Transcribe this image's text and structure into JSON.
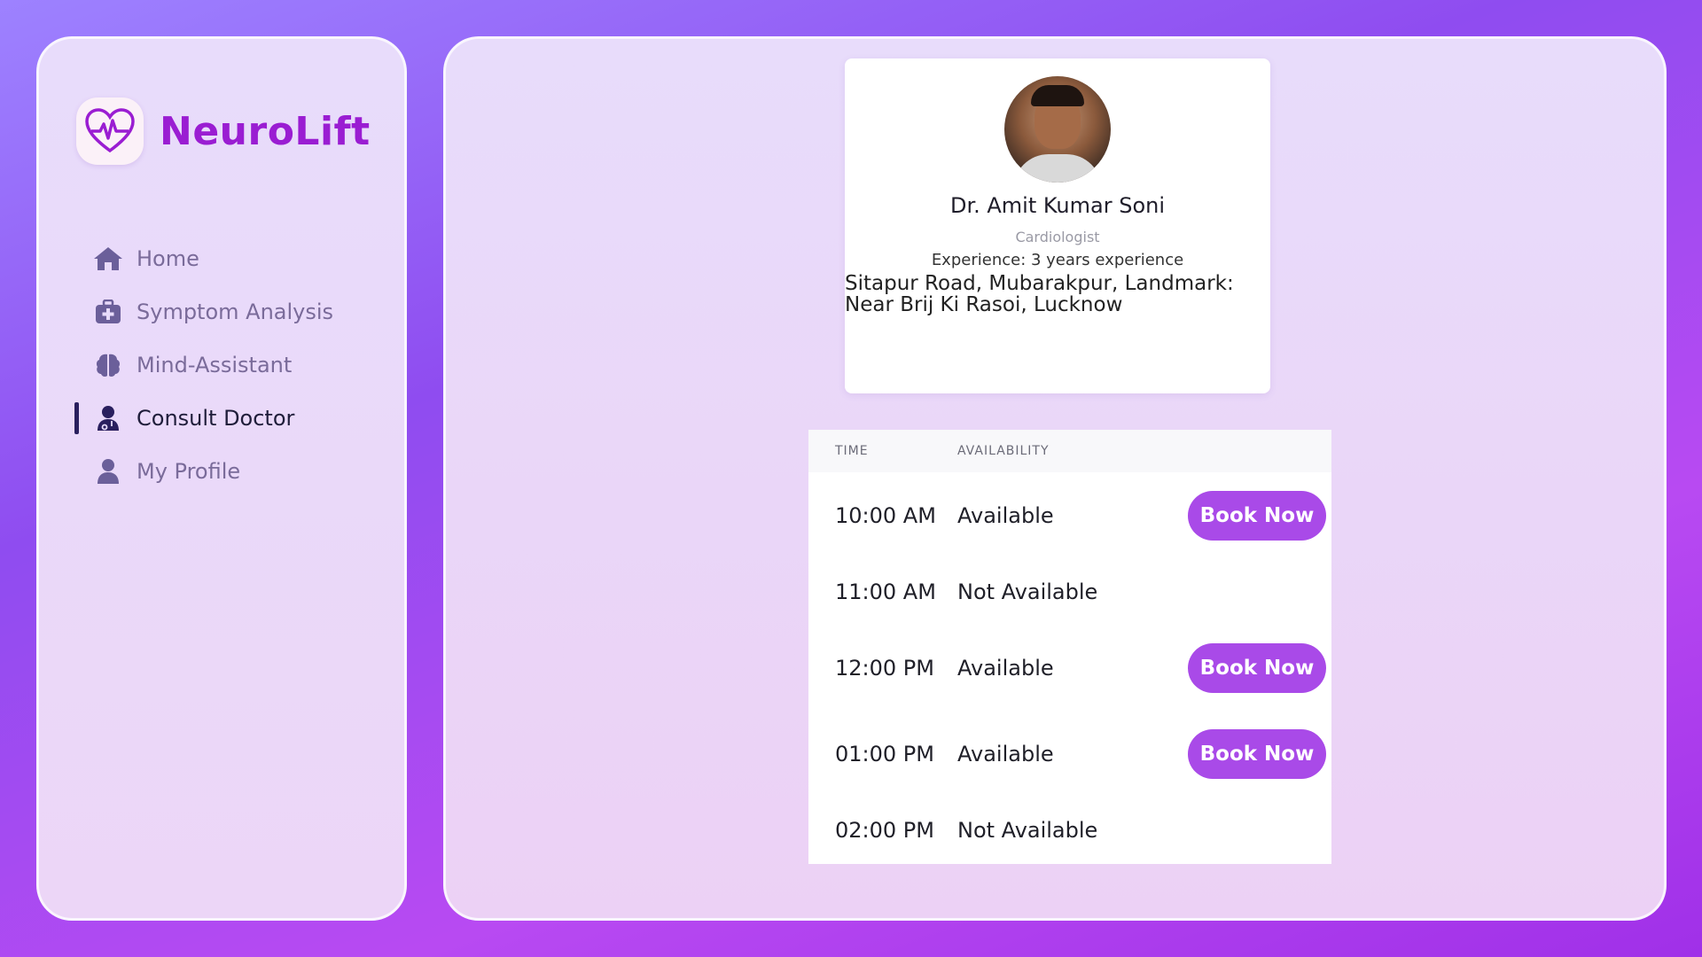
{
  "brand": {
    "name": "NeuroLift"
  },
  "nav": {
    "items": [
      {
        "label": "Home",
        "icon": "home-icon",
        "active": false
      },
      {
        "label": "Symptom Analysis",
        "icon": "medkit-icon",
        "active": false
      },
      {
        "label": "Mind-Assistant",
        "icon": "brain-icon",
        "active": false
      },
      {
        "label": "Consult Doctor",
        "icon": "doctor-icon",
        "active": true
      },
      {
        "label": "My Profile",
        "icon": "user-icon",
        "active": false
      }
    ]
  },
  "doctor": {
    "name": "Dr. Amit Kumar Soni",
    "specialty": "Cardiologist",
    "experience": "Experience: 3 years experience",
    "address": "Sitapur Road, Mubarakpur, Landmark: Near Brij Ki Rasoi, Lucknow"
  },
  "slots": {
    "headers": {
      "time": "TIME",
      "availability": "AVAILABILITY"
    },
    "book_label": "Book Now",
    "rows": [
      {
        "time": "10:00 AM",
        "status": "Available"
      },
      {
        "time": "11:00 AM",
        "status": "Not Available"
      },
      {
        "time": "12:00 PM",
        "status": "Available"
      },
      {
        "time": "01:00 PM",
        "status": "Available"
      },
      {
        "time": "02:00 PM",
        "status": "Not Available"
      }
    ]
  },
  "colors": {
    "brand": "#9a1dd2",
    "button": "#a94ae8",
    "nav_icon": "#6b5f9a",
    "active_indicator": "#2a1f5e"
  }
}
